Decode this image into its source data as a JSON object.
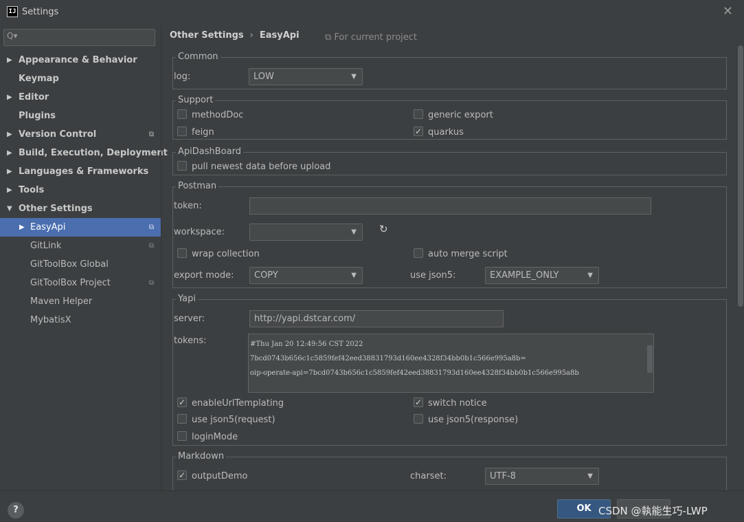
{
  "window": {
    "title": "Settings",
    "app_icon_text": "IJ",
    "close_glyph": "✕"
  },
  "sidebar": {
    "search_placeholder": "",
    "search_icon": "Q▾",
    "items": [
      {
        "label": "Appearance & Behavior",
        "arrow": "▶"
      },
      {
        "label": "Keymap",
        "arrow": ""
      },
      {
        "label": "Editor",
        "arrow": "▶"
      },
      {
        "label": "Plugins",
        "arrow": ""
      },
      {
        "label": "Version Control",
        "arrow": "▶"
      },
      {
        "label": "Build, Execution, Deployment",
        "arrow": "▶"
      },
      {
        "label": "Languages & Frameworks",
        "arrow": "▶"
      },
      {
        "label": "Tools",
        "arrow": "▶"
      },
      {
        "label": "Other Settings",
        "arrow": "▼"
      },
      {
        "label": "EasyApi",
        "arrow": "▶"
      },
      {
        "label": "GitLink",
        "arrow": ""
      },
      {
        "label": "GitToolBox Global",
        "arrow": ""
      },
      {
        "label": "GitToolBox Project",
        "arrow": ""
      },
      {
        "label": "Maven Helper",
        "arrow": ""
      },
      {
        "label": "MybatisX",
        "arrow": ""
      }
    ],
    "project_glyph": "⧉"
  },
  "breadcrumb": {
    "parent": "Other Settings",
    "separator": "›",
    "current": "EasyApi",
    "scope": "⧉ For current project"
  },
  "common": {
    "title": "Common",
    "log_label": "log:",
    "log_value": "LOW"
  },
  "support": {
    "title": "Support",
    "methodDoc": "methodDoc",
    "feign": "feign",
    "generic_export": "generic export",
    "quarkus": "quarkus"
  },
  "apidashboard": {
    "title": "ApiDashBoard",
    "pull": "pull newest data before upload"
  },
  "postman": {
    "title": "Postman",
    "token_label": "token:",
    "token_value": "",
    "workspace_label": "workspace:",
    "workspace_value": "",
    "refresh_icon": "↻",
    "wrap_collection": "wrap collection",
    "auto_merge": "auto merge script",
    "export_mode_label": "export mode:",
    "export_mode_value": "COPY",
    "use_json5_label": "use json5:",
    "use_json5_value": "EXAMPLE_ONLY"
  },
  "yapi": {
    "title": "Yapi",
    "server_label": "server:",
    "server_value": "http://yapi.dstcar.com/",
    "tokens_label": "tokens:",
    "tokens_lines": [
      "#Thu Jan 20 12:49:56 CST 2022",
      "7bcd0743b656c1c5859fef42eed38831793d160ee4328f34bb0b1c566e995a8b=",
      "oip-operate-api=7bcd0743b656c1c5859fef42eed38831793d160ee4328f34bb0b1c566e995a8b"
    ],
    "enableUrlTemplating": "enableUrlTemplating",
    "switch_notice": "switch notice",
    "use_json5_request": "use json5(request)",
    "use_json5_response": "use json5(response)",
    "loginMode": "loginMode"
  },
  "markdown": {
    "title": "Markdown",
    "outputDemo": "outputDemo",
    "charset_label": "charset:",
    "charset_value": "UTF-8"
  },
  "caret": "▼",
  "footer": {
    "help": "?",
    "ok": "OK",
    "watermark": "CSDN @執能生巧-LWP"
  }
}
